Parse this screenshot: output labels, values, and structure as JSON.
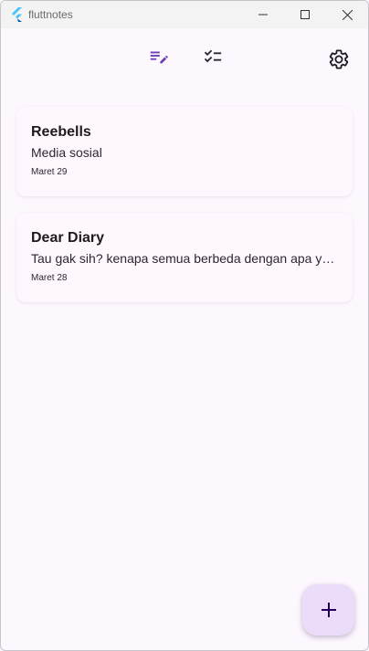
{
  "window": {
    "title": "fluttnotes"
  },
  "toolbar": {
    "tabs": [
      {
        "name": "notes",
        "icon": "edit-note-icon",
        "selected": true
      },
      {
        "name": "todo",
        "icon": "checklist-icon",
        "selected": false
      }
    ],
    "settings_icon": "gear-icon"
  },
  "notes": [
    {
      "title": "Reebells",
      "body": "Media sosial",
      "date": "Maret 29"
    },
    {
      "title": "Dear Diary",
      "body": "Tau gak sih? kenapa semua berbeda dengan apa yang kamu pikirkan",
      "date": "Maret 28"
    }
  ],
  "fab": {
    "icon": "plus-icon"
  },
  "colors": {
    "accent": "#6a3cb5",
    "background": "#fdf7fe",
    "fab": "#ebdcfa"
  }
}
